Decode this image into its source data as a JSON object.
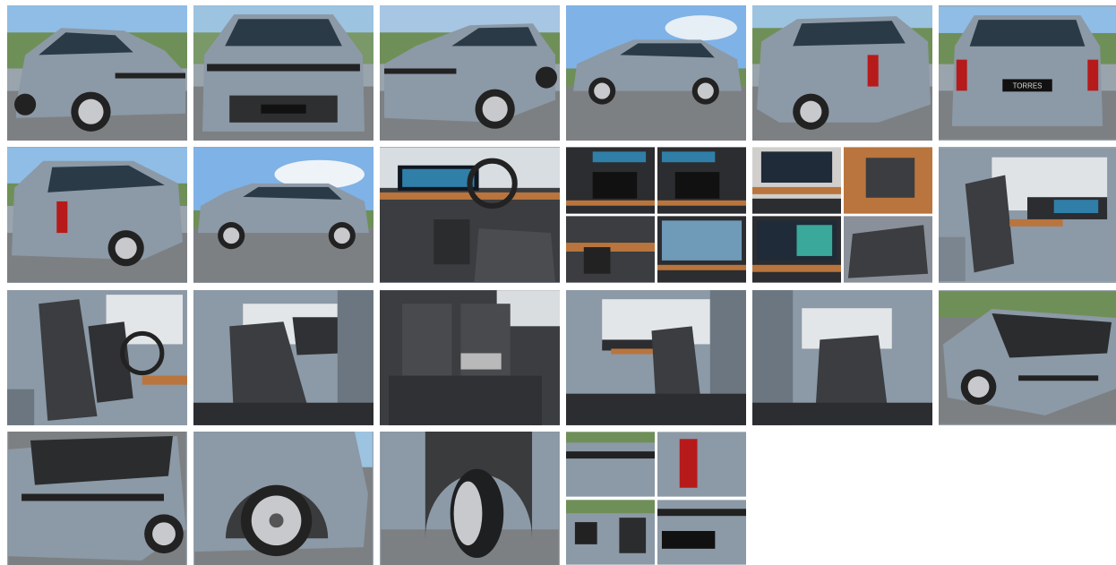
{
  "gallery": {
    "plate_text": "TORRES",
    "thumbnails": [
      {
        "id": "front-three-quarter-left",
        "kind": "exterior-front-angle-left"
      },
      {
        "id": "front-straight",
        "kind": "exterior-front"
      },
      {
        "id": "front-three-quarter-right",
        "kind": "exterior-front-angle-right"
      },
      {
        "id": "side-profile-left",
        "kind": "exterior-side"
      },
      {
        "id": "rear-three-quarter-right",
        "kind": "exterior-rear-angle"
      },
      {
        "id": "rear-straight",
        "kind": "exterior-rear"
      },
      {
        "id": "rear-three-quarter-left",
        "kind": "exterior-rear-angle"
      },
      {
        "id": "side-profile-left-far",
        "kind": "exterior-side"
      },
      {
        "id": "dashboard-overview",
        "kind": "interior-dash"
      },
      {
        "id": "console-collage",
        "kind": "collage-interior"
      },
      {
        "id": "camera-collage",
        "kind": "collage-interior"
      },
      {
        "id": "driver-seat-doorway",
        "kind": "interior-seat"
      },
      {
        "id": "front-seats-doorway",
        "kind": "interior-seat"
      },
      {
        "id": "rear-seats-left-door",
        "kind": "interior-rear"
      },
      {
        "id": "rear-bench-armrest",
        "kind": "interior-rear"
      },
      {
        "id": "front-passenger-doorway",
        "kind": "interior-seat"
      },
      {
        "id": "rear-seats-right-door",
        "kind": "interior-rear"
      },
      {
        "id": "engine-bay-angle",
        "kind": "engine"
      },
      {
        "id": "engine-bay-close",
        "kind": "engine"
      },
      {
        "id": "front-wheel-arch",
        "kind": "wheel"
      },
      {
        "id": "front-tyre-close",
        "kind": "wheel"
      },
      {
        "id": "details-collage",
        "kind": "collage-exterior"
      }
    ]
  },
  "colors": {
    "sky": "#8fbde6",
    "body": "#8c99a6",
    "asphalt": "#7d8083",
    "leather": "#3b3d40",
    "trim": "#b9753d"
  }
}
